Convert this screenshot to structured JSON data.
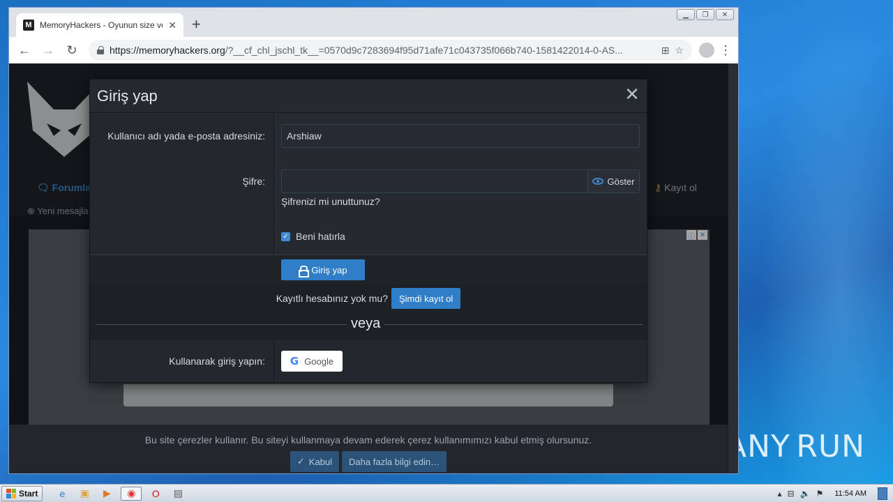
{
  "browser": {
    "tab_title": "MemoryHackers - Oyunun size verdi",
    "url_host": "https://memoryhackers.org",
    "url_rest": "/?__cf_chl_jschl_tk__=0570d9c7283694f95d71afe71c043735f066b740-1581422014-0-AS..."
  },
  "page": {
    "nav_forum": "Forumla",
    "nav_register": "Kayıt ol",
    "new_posts": "Yeni mesajla"
  },
  "modal": {
    "title": "Giriş yap",
    "username_label": "Kullanıcı adı yada e-posta adresiniz:",
    "username_value": "Arshiaw",
    "password_label": "Şifre:",
    "password_value": "",
    "show_label": "Göster",
    "forgot_label": "Şifrenizi mi unuttunuz?",
    "remember_label": "Beni hatırla",
    "remember_checked": true,
    "login_button": "Giriş yap",
    "no_account_text": "Kayıtlı hesabınız yok mu?",
    "register_button": "Şimdi kayıt ol",
    "or_label": "veya",
    "social_label": "Kullanarak giriş yapın:",
    "google_button": "Google"
  },
  "cookie": {
    "text": "Bu site çerezler kullanır. Bu siteyi kullanmaya devam ederek çerez kullanımımızı kabul etmiş olursunuz.",
    "accept_button": "Kabul",
    "more_button": "Daha fazla bilgi edin…"
  },
  "taskbar": {
    "start_label": "Start",
    "clock": "11:54 AM"
  },
  "watermark": "ANY RUN",
  "colors": {
    "accent": "#2f7ec7",
    "modal_bg": "#252a31",
    "desktop": "#2a8be0"
  }
}
